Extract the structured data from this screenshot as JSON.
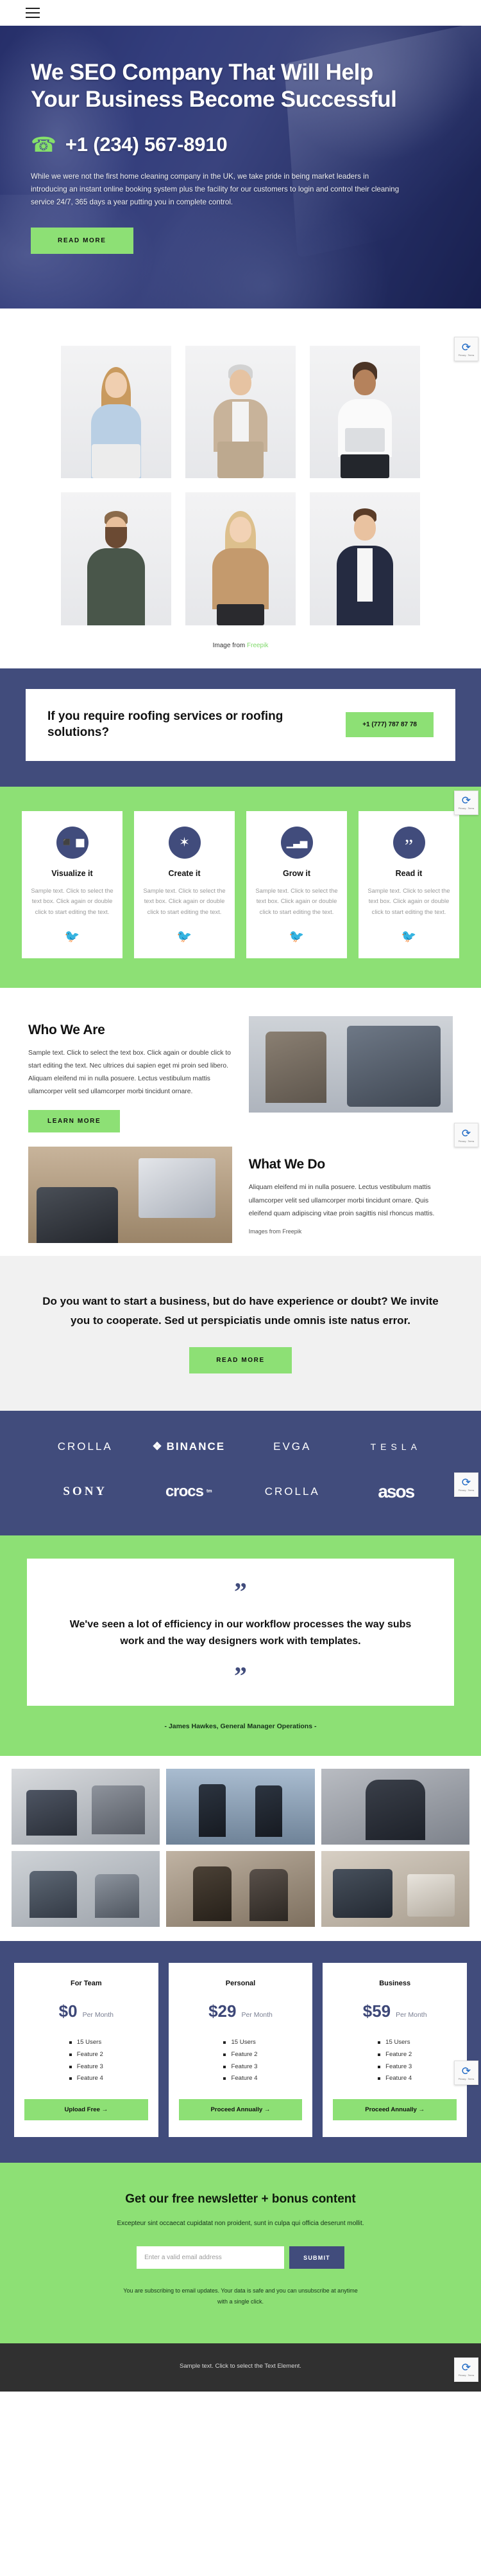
{
  "nav": {
    "menu_icon": "hamburger-menu-icon"
  },
  "hero": {
    "title": "We SEO Company That Will Help Your Business Become Successful",
    "phone_icon": "phone-icon",
    "phone": "+1 (234) 567-8910",
    "paragraph": "While we were not the first home cleaning company in the UK, we take pride in being market leaders in introducing an instant online booking system plus the facility for our customers to login and control their cleaning service 24/7, 365 days a year putting you in complete control.",
    "cta_label": "READ MORE"
  },
  "team": {
    "caption_prefix": "Image from ",
    "caption_link": "Freepik",
    "members": [
      {
        "name": "woman-blue-shirt-photo"
      },
      {
        "name": "man-beige-suit-photo"
      },
      {
        "name": "woman-laptop-photo"
      },
      {
        "name": "bearded-man-green-shirt-photo"
      },
      {
        "name": "woman-tan-sweater-photo"
      },
      {
        "name": "man-navy-blazer-coffee-photo"
      }
    ]
  },
  "roofing": {
    "title": "If you require roofing services or roofing solutions?",
    "phone_label": "+1 (777) 787 87 78"
  },
  "features": {
    "sample_text": "Sample text. Click to select the text box. Click again or double click to start editing the text.",
    "items": [
      {
        "icon": "shapes-icon",
        "glyph": "◩",
        "title": "Visualize it"
      },
      {
        "icon": "node-network-icon",
        "glyph": "✴",
        "title": "Create it"
      },
      {
        "icon": "bar-chart-up-icon",
        "glyph": "▂▄▆",
        "title": "Grow it"
      },
      {
        "icon": "quote-icon",
        "glyph": "”",
        "title": "Read it"
      }
    ],
    "social_icon": "twitter-bird-icon"
  },
  "who_we_are": {
    "heading": "Who We Are",
    "body": "Sample text. Click to select the text box. Click again or double click to start editing the text. Nec ultrices dui sapien eget mi proin sed libero. Aliquam eleifend mi in nulla posuere. Lectus vestibulum mattis ullamcorper velit sed ullamcorper morbi tincidunt ornare.",
    "cta_label": "LEARN MORE",
    "image_name": "team-meeting-photo"
  },
  "what_we_do": {
    "heading": "What We Do",
    "body": "Aliquam eleifend mi in nulla posuere. Lectus vestibulum mattis ullamcorper velit sed ullamcorper morbi tincidunt ornare. Quis eleifend quam adipiscing vitae proin sagittis nisl rhoncus mattis.",
    "images_caption": "Images from Freepik",
    "image_name": "desk-collaboration-photo"
  },
  "cta": {
    "title": "Do you want to start a business, but do have experience or doubt? We invite you to cooperate. Sed ut perspiciatis unde omnis iste natus error.",
    "button_label": "READ MORE"
  },
  "logos": {
    "row1": [
      {
        "name": "crolla-logo",
        "text": "CROLLA",
        "style": "thin"
      },
      {
        "name": "binance-logo",
        "text": "BINANCE",
        "style": "bold",
        "mark": "❖"
      },
      {
        "name": "evga-logo",
        "text": "EVGA",
        "style": "thin"
      },
      {
        "name": "tesla-logo",
        "text": "TESLA",
        "style": "tesla"
      }
    ],
    "row2": [
      {
        "name": "sony-logo",
        "text": "SONY",
        "style": "serif"
      },
      {
        "name": "crocs-logo",
        "text": "crocs",
        "style": "round",
        "sup": "tm"
      },
      {
        "name": "crolla-logo-2",
        "text": "CROLLA",
        "style": "thin"
      },
      {
        "name": "asos-logo",
        "text": "asos",
        "style": "round"
      }
    ]
  },
  "testimonial": {
    "open_quote": "”",
    "close_quote": "”",
    "text": "We've seen a lot of efficiency in our workflow processes the way subs work and the way designers work with templates.",
    "author": "- James Hawkes, General Manager Operations -"
  },
  "gallery": {
    "cells": [
      {
        "name": "office-discussion-photo"
      },
      {
        "name": "silhouette-meeting-photo"
      },
      {
        "name": "woman-headphones-photo"
      },
      {
        "name": "coworkers-laptop-photo"
      },
      {
        "name": "team-brainstorm-photo"
      },
      {
        "name": "desk-tablet-photo"
      }
    ]
  },
  "pricing": {
    "plans": [
      {
        "name": "For Team",
        "price": "$0",
        "period": "Per Month",
        "features": [
          "15 Users",
          "Feature 2",
          "Feature 3",
          "Feature 4"
        ],
        "button_label": "Upload Free →"
      },
      {
        "name": "Personal",
        "price": "$29",
        "period": "Per Month",
        "features": [
          "15 Users",
          "Feature 2",
          "Feature 3",
          "Feature 4"
        ],
        "button_label": "Proceed Annually →"
      },
      {
        "name": "Business",
        "price": "$59",
        "period": "Per Month",
        "features": [
          "15 Users",
          "Feature 2",
          "Feature 3",
          "Feature 4"
        ],
        "button_label": "Proceed Annually →"
      }
    ]
  },
  "newsletter": {
    "title": "Get our free newsletter + bonus content",
    "subtitle": "Excepteur sint occaecat cupidatat non proident, sunt in culpa qui officia deserunt mollit.",
    "input_placeholder": "Enter a valid email address",
    "input_value": "",
    "submit_label": "SUBMIT",
    "fine_print": "You are subscribing to email updates. Your data is safe and you can unsubscribe at anytime with a single click."
  },
  "footer": {
    "text": "Sample text. Click to select the Text Element."
  },
  "recaptcha": {
    "icon": "recaptcha-icon",
    "label": "Privacy - Terms"
  },
  "colors": {
    "navy": "#414c7c",
    "green": "#8de075",
    "light_grey": "#f1f1f1",
    "footer_dark": "#303030"
  }
}
